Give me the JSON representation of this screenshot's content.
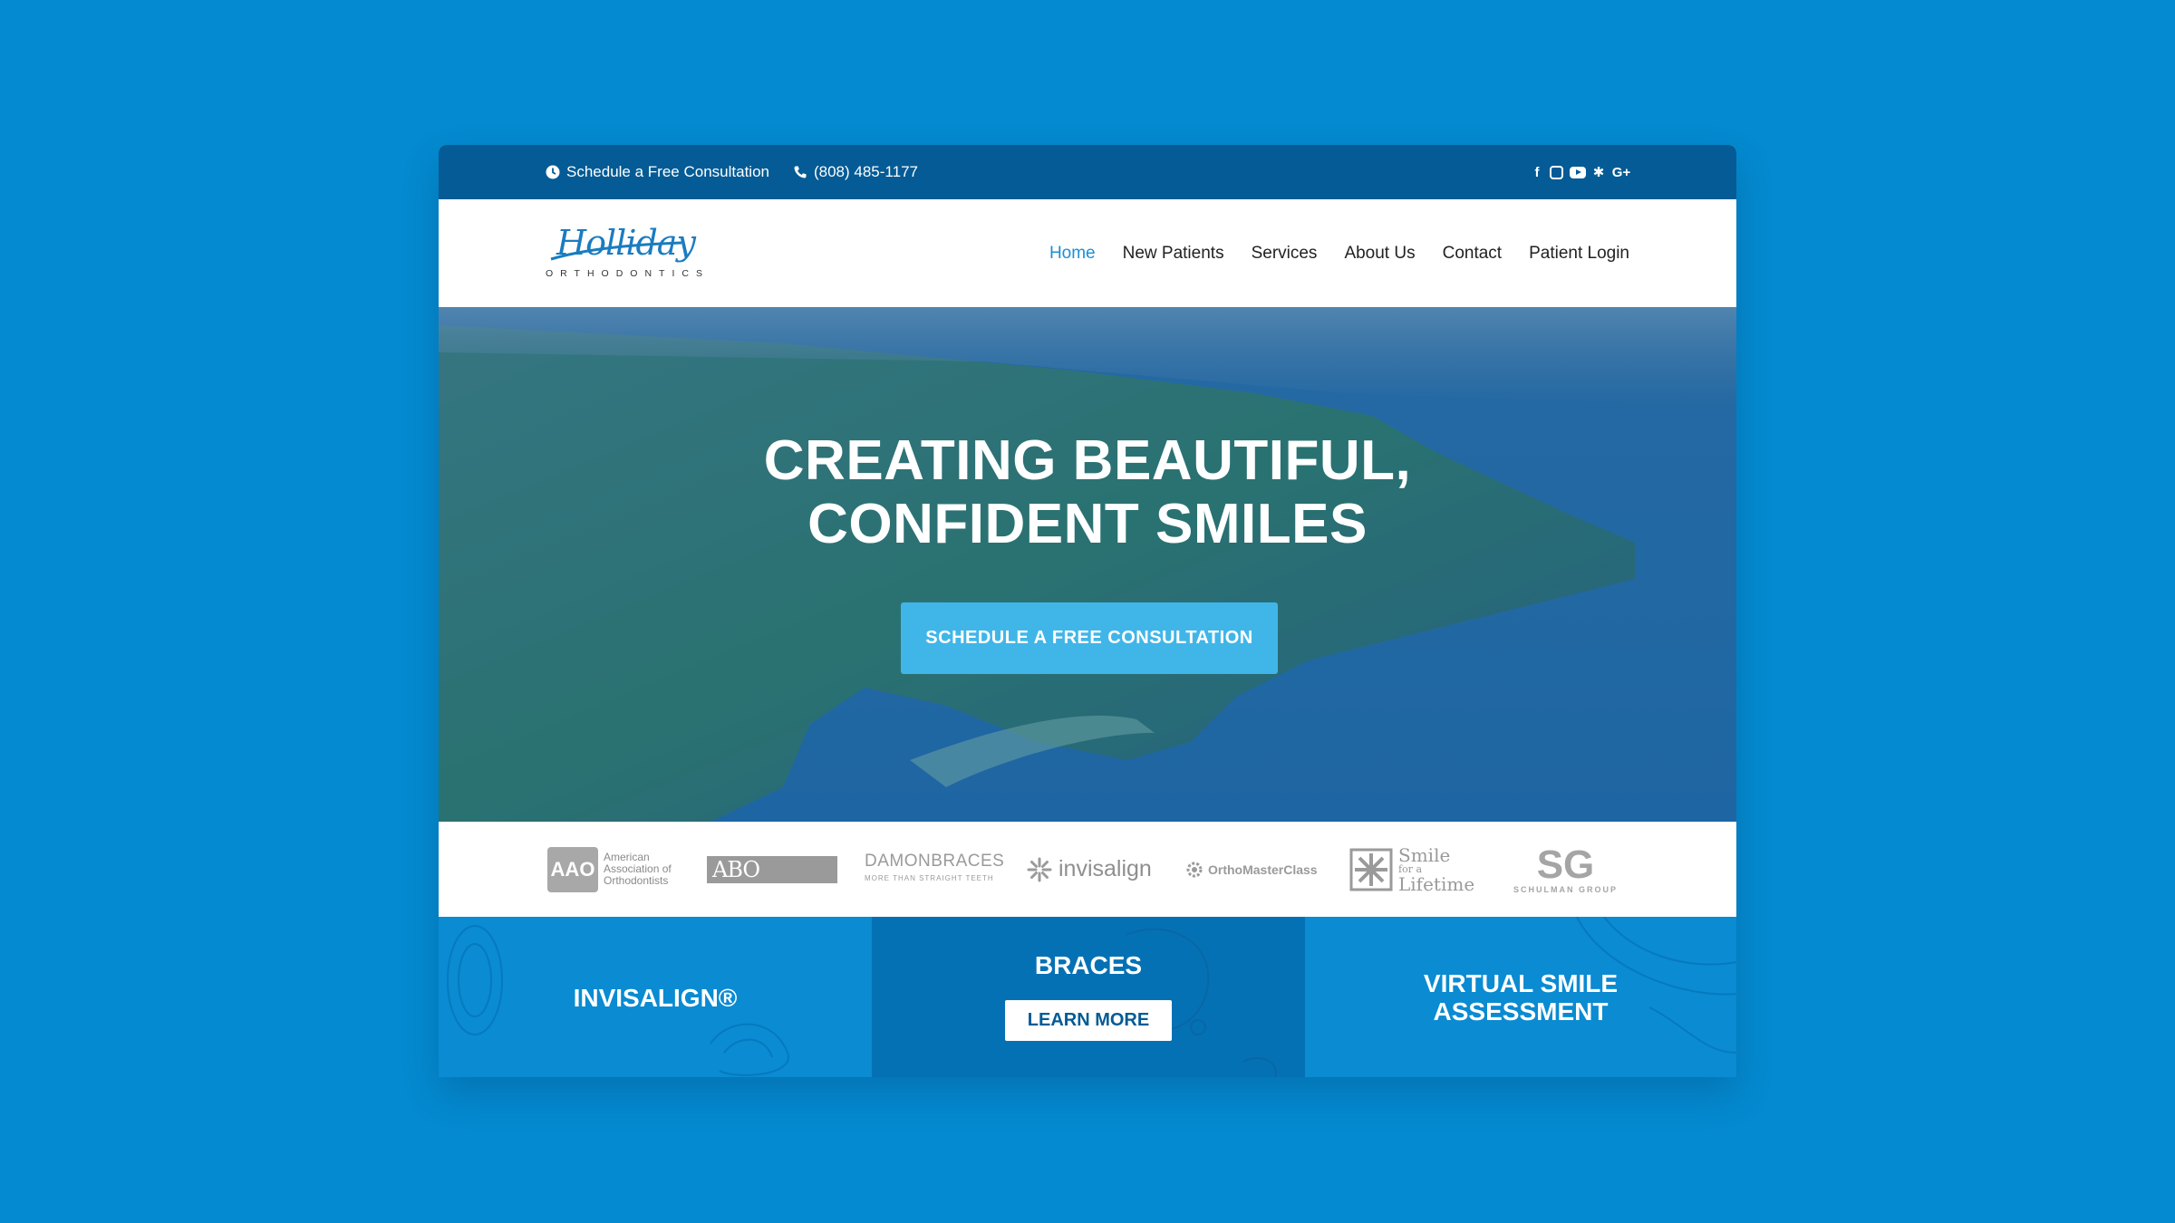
{
  "topbar": {
    "consultation": "Schedule a Free Consultation",
    "phone": "(808) 485-1177",
    "social": [
      "facebook-icon",
      "instagram-icon",
      "youtube-icon",
      "yelp-icon",
      "google-plus-icon"
    ],
    "social_glyphs": {
      "facebook": "f",
      "yelp": "✱",
      "google": "G+"
    }
  },
  "header": {
    "logo_script": "Holliday",
    "logo_sub": "ORTHODONTICS",
    "nav": [
      "Home",
      "New Patients",
      "Services",
      "About Us",
      "Contact",
      "Patient Login"
    ],
    "active": "Home"
  },
  "hero": {
    "line1": "CREATING BEAUTIFUL,",
    "line2": "CONFIDENT SMILES",
    "cta": "SCHEDULE A FREE CONSULTATION"
  },
  "affiliations": {
    "aao_mark": "AAO",
    "aao_text": [
      "American",
      "Association of",
      "Orthodontists"
    ],
    "abo_mark": "ABO",
    "damon": "DAMONBRACES",
    "damon_tag": "MORE THAN STRAIGHT TEETH",
    "invisalign": "invisalign",
    "omc": "OrthoMasterClass",
    "sfl": [
      "Smile",
      "for a",
      "Lifetime"
    ],
    "sg": "SG",
    "sg_text": "SCHULMAN GROUP"
  },
  "tiles": {
    "invisalign": "INVISALIGN®",
    "braces": "BRACES",
    "learn_more": "LEARN MORE",
    "vsa_line1": "VIRTUAL SMILE",
    "vsa_line2": "ASSESSMENT"
  },
  "colors": {
    "page_bg": "#048ad0",
    "topbar": "#045b95",
    "accent": "#1b8fd6",
    "cta": "#40b6e8",
    "tile_light": "#0a8bd2",
    "tile_dark": "#0571b5"
  }
}
